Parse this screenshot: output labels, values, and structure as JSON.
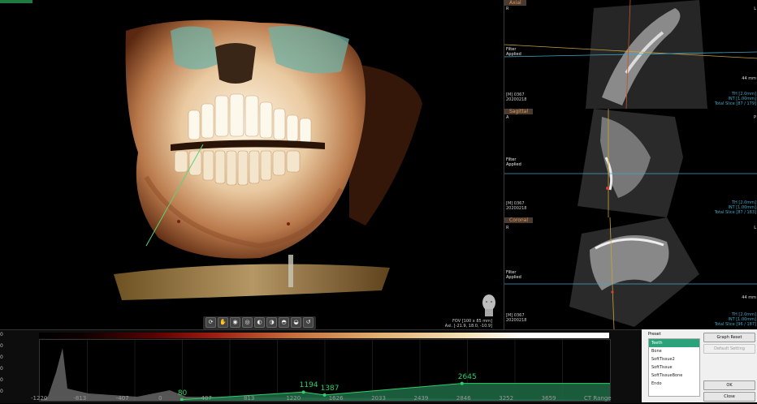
{
  "viewer3d": {
    "fov_line1": "FOV [100 x 85 mm]",
    "fov_line2": "Axi. [-21.9, 18.0, -10.9]",
    "toolbar_icons": [
      "rotate-icon",
      "hand-icon",
      "front-view-icon",
      "back-view-icon",
      "left-view-icon",
      "right-view-icon",
      "top-view-icon",
      "bottom-view-icon",
      "reset-view-icon"
    ]
  },
  "axial": {
    "label": "Axial",
    "corner_left": "R",
    "corner_right": "L",
    "filter": [
      "Filter",
      "Applied"
    ],
    "mm": "44 mm",
    "info_left": [
      "[M] 0367",
      "20200218"
    ],
    "info_right": [
      "TH [2.0mm]",
      "INT [1.00mm]",
      "Total Slice [87 / 179]"
    ]
  },
  "sagittal": {
    "label": "Sagittal",
    "corner_left": "A",
    "corner_right": "P",
    "filter": [
      "Filter",
      "Applied"
    ],
    "info_left": [
      "[M] 0367",
      "20200218"
    ],
    "info_right": [
      "TH [2.0mm]",
      "INT [1.00mm]",
      "Total Slice [87 / 183]"
    ]
  },
  "coronal": {
    "label": "Coronal",
    "corner_left": "R",
    "corner_right": "L",
    "filter": [
      "Filter",
      "Applied"
    ],
    "mm": "44 mm",
    "info_left": [
      "[M] 0367",
      "20200218"
    ],
    "info_right": [
      "TH [2.0mm]",
      "INT [1.00mm]",
      "Total Slice [96 / 187]"
    ]
  },
  "histogram": {
    "y_labels": [
      "0",
      "0",
      "0",
      "0",
      "0",
      "0"
    ],
    "x_labels": [
      "-1220",
      "-813",
      "-407",
      "0",
      "407",
      "813",
      "1220",
      "1626",
      "2033",
      "2439",
      "2846",
      "3252",
      "3659",
      "CT Range"
    ],
    "control_points": [
      {
        "label": "80",
        "value": 80,
        "opacity": 0.02
      },
      {
        "label": "1194",
        "value": 1194,
        "opacity": 0.15
      },
      {
        "label": "1387",
        "value": 1387,
        "opacity": 0.1
      },
      {
        "label": "2645",
        "value": 2645,
        "opacity": 0.3
      }
    ],
    "colors": {
      "curve": "#2fd06a",
      "fill": "#1f6b45"
    }
  },
  "presets": {
    "title": "Preset",
    "items": [
      "Teeth",
      "Bone",
      "SoftTissue2",
      "SoftTissue",
      "SoftTissueBone",
      "Endo"
    ],
    "selected_index": 0,
    "buttons": {
      "graph_reset": "Graph Reset",
      "default_setting": "Default Setting",
      "ok": "OK",
      "close": "Close"
    },
    "colors": {
      "selected": "#2aa37a"
    }
  }
}
